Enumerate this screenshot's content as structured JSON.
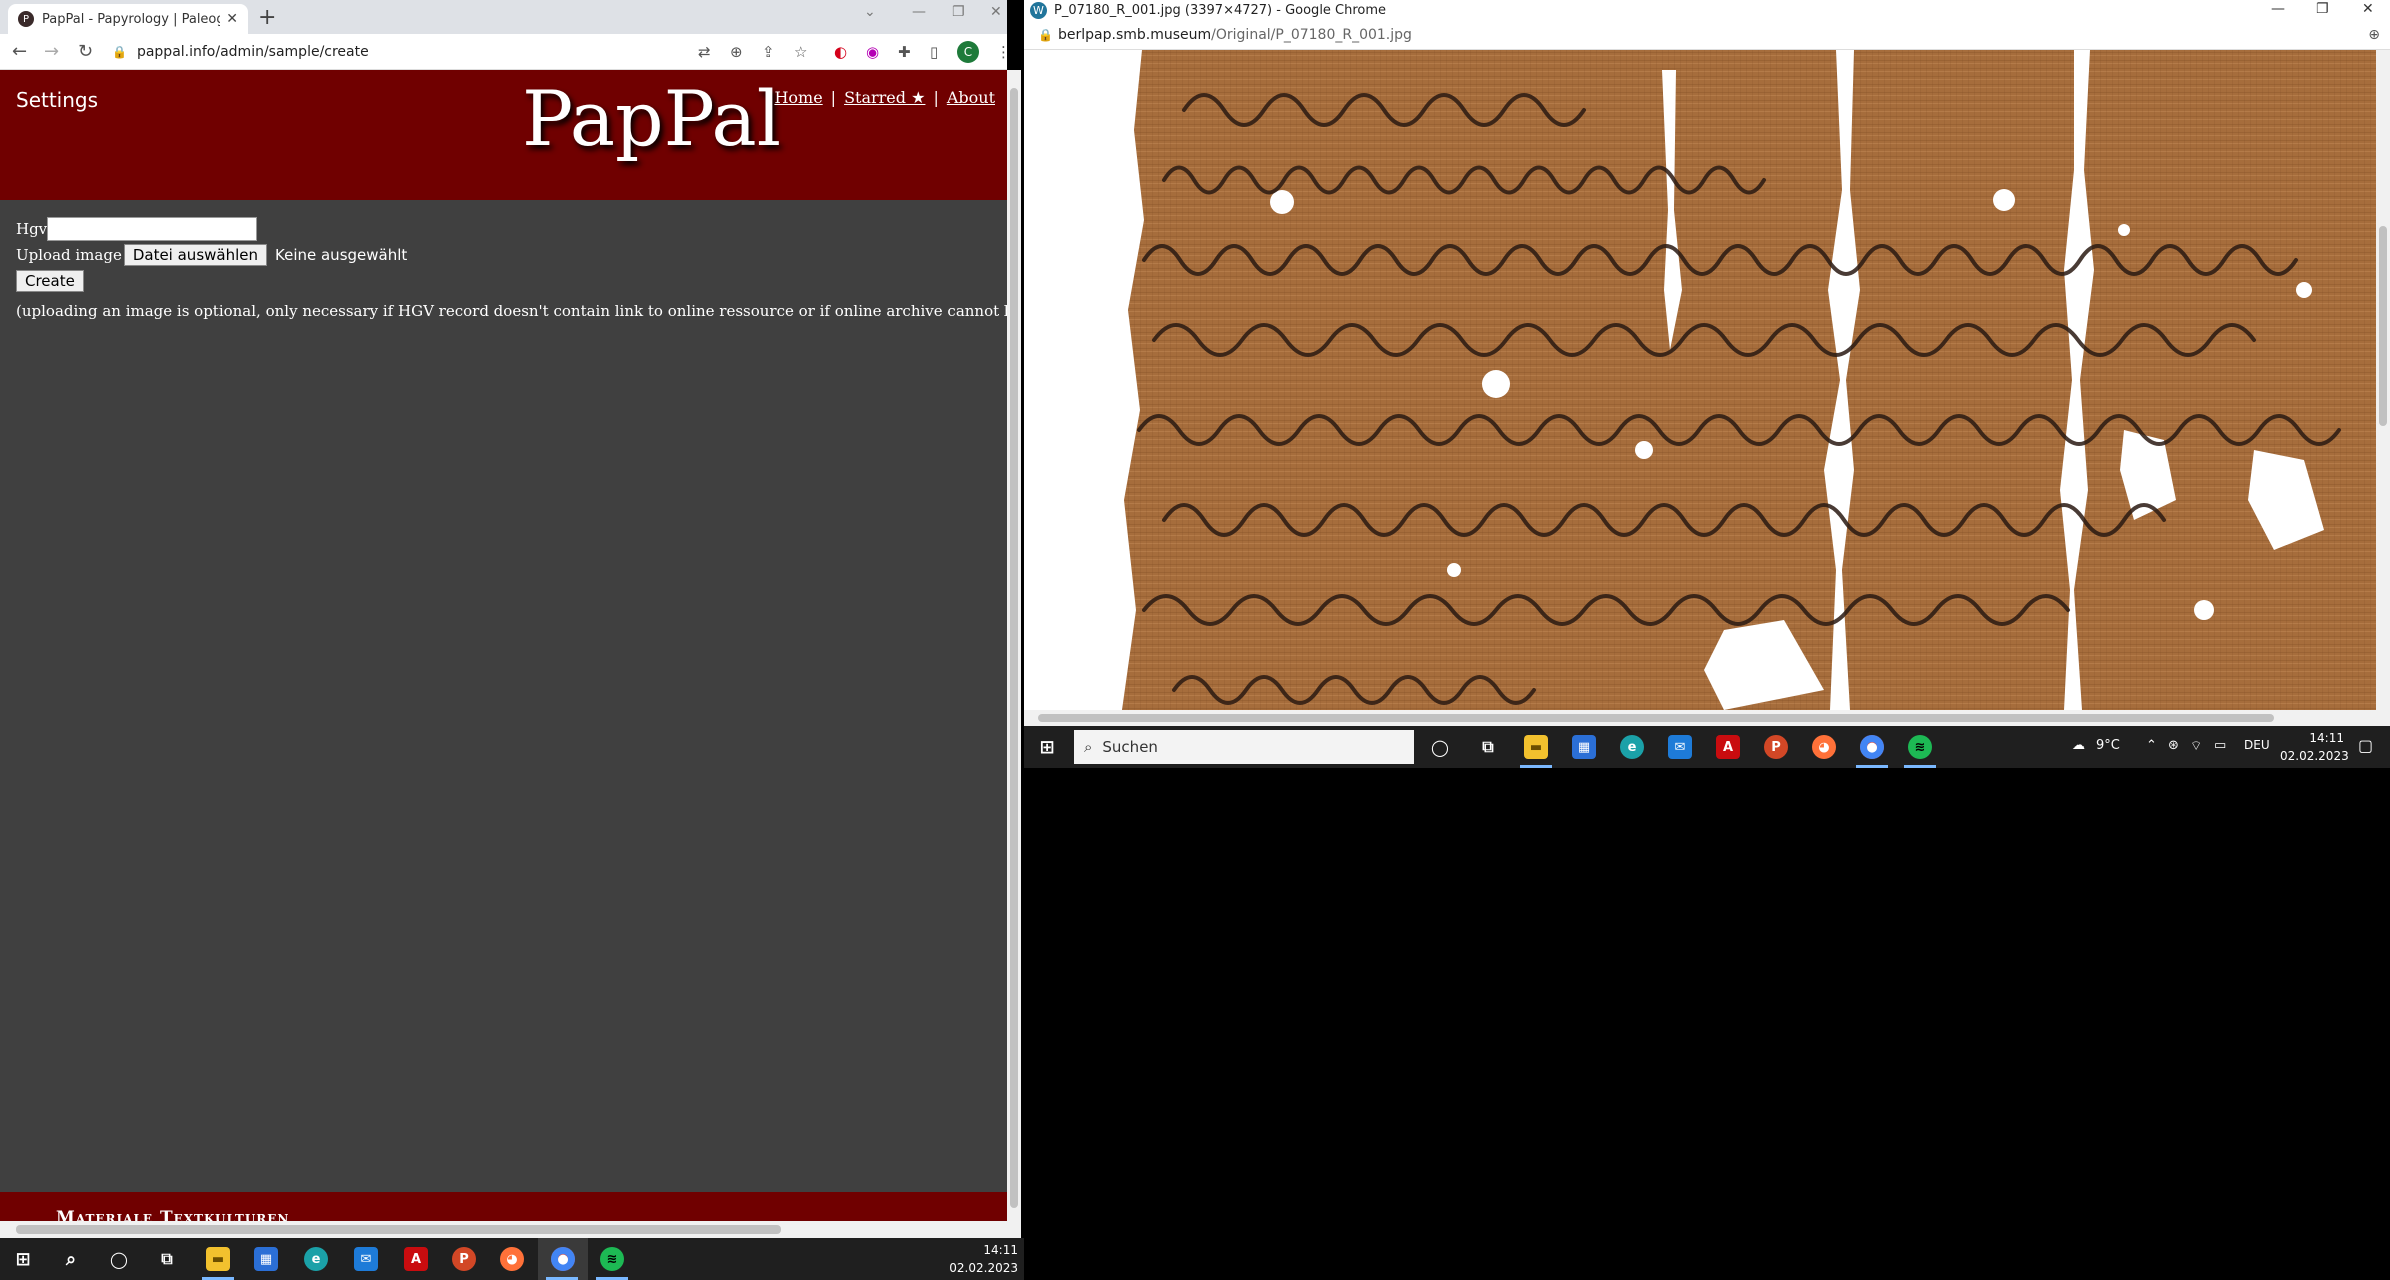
{
  "left_browser": {
    "tab_title": "PapPal - Papyrology | Paleograph",
    "url": "pappal.info/admin/sample/create",
    "profile_initial": "C"
  },
  "site": {
    "settings_label": "Settings",
    "logo": "PapPal",
    "nav": {
      "home": "Home",
      "starred": "Starred ★",
      "about": "About"
    },
    "form": {
      "hgv_label": "Hgv",
      "hgv_value": "",
      "upload_label": "Upload image",
      "choose_file_button": "Datei auswählen",
      "no_file_text": "Keine ausgewählt",
      "create_button": "Create",
      "note": "(uploading an image is optional, only necessary if HGV record doesn't contain link to online ressource or if online archive cannot be harveste"
    },
    "footer_text": "Materiale Textkulturen"
  },
  "right_browser": {
    "window_title": "P_07180_R_001.jpg (3397×4727) - Google Chrome",
    "url_host": "berlpap.smb.museum",
    "url_path": "/Original/P_07180_R_001.jpg"
  },
  "taskbar_left": {
    "time": "14:11",
    "date": "02.02.2023"
  },
  "taskbar_right": {
    "search_placeholder": "Suchen",
    "weather": "9°C",
    "language": "DEU",
    "time": "14:11",
    "date": "02.02.2023"
  },
  "colors": {
    "header_bg": "#700000",
    "page_bg": "#404040",
    "papyrus": "#a9713f"
  },
  "icons": [
    "back-icon",
    "forward-icon",
    "reload-icon",
    "lock-icon",
    "translate-icon",
    "zoom-icon",
    "share-icon",
    "star-icon",
    "extension-icon",
    "windows-start-icon",
    "search-icon",
    "task-view-icon",
    "file-explorer-icon",
    "store-icon",
    "edge-icon",
    "mail-icon",
    "acrobat-icon",
    "powerpoint-icon",
    "firefox-icon",
    "chrome-icon",
    "spotify-icon",
    "weather-icon",
    "notification-icon"
  ]
}
